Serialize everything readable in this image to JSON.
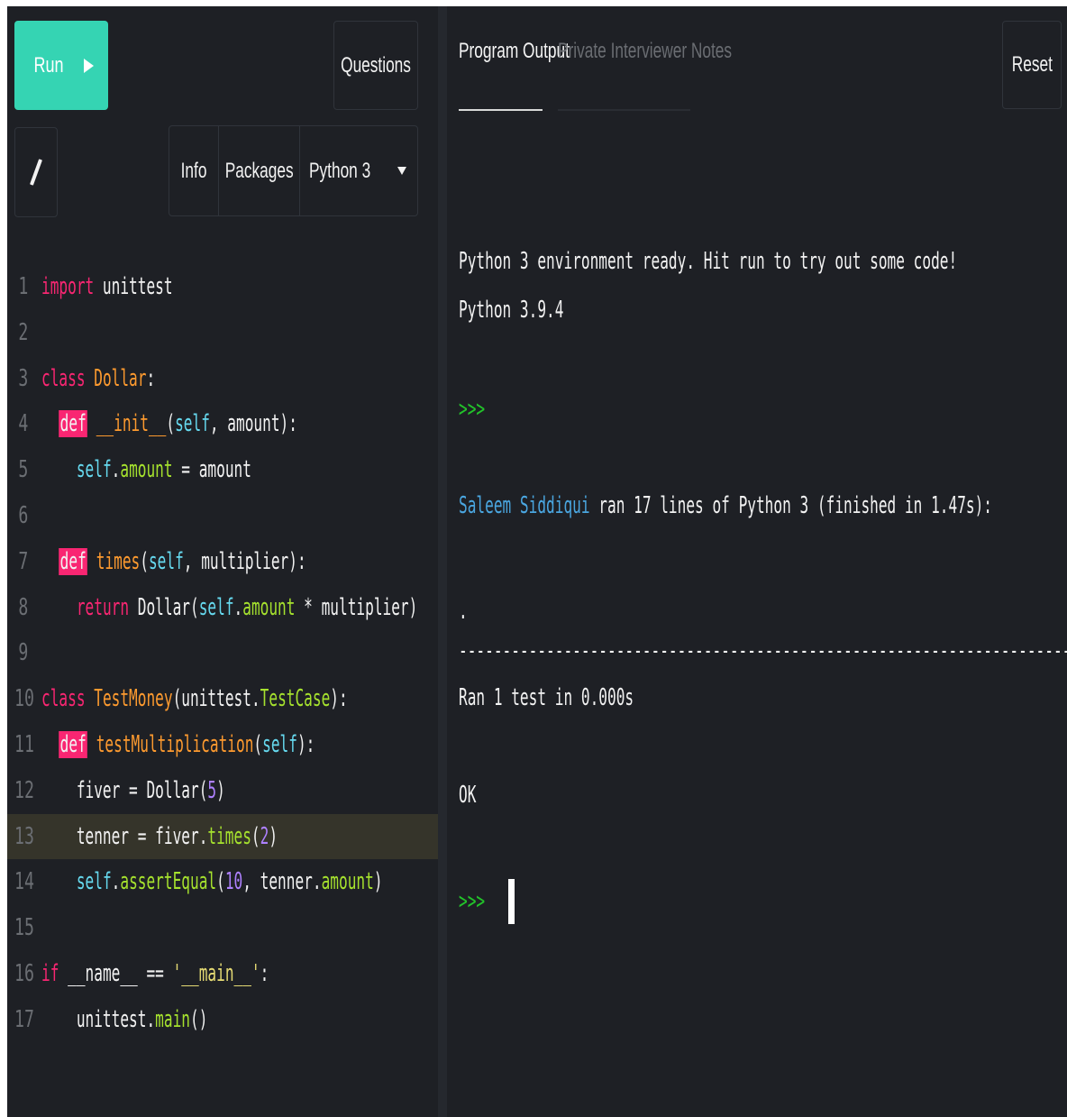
{
  "toolbar": {
    "run_label": "Run",
    "questions_label": "Questions",
    "info_label": "Info",
    "packages_label": "Packages",
    "language": "Python 3"
  },
  "tabs": {
    "output_label": "Program Output",
    "notes_label": "Private Interviewer Notes",
    "reset_label": "Reset"
  },
  "editor": {
    "highlighted_line": 13,
    "line_numbers": [
      "1",
      "2",
      "3",
      "4",
      "5",
      "6",
      "7",
      "8",
      "9",
      "10",
      "11",
      "12",
      "13",
      "14",
      "15",
      "16",
      "17"
    ]
  },
  "console": {
    "ready_text": "Python 3 environment ready. Hit run to try out some code!",
    "version_text": "Python 3.9.4",
    "prompt": ">>>",
    "user_name": "Saleem Siddiqui",
    "run_summary": " ran 17 lines of Python 3 (finished in 1.47s):",
    "dot_line": ".",
    "separator": "----------------------------------------------------------------------",
    "ran_line": "Ran 1 test in 0.000s",
    "ok_line": "OK"
  },
  "colors": {
    "run_button": "#35d4b3",
    "keyword": "#f92672",
    "class_name": "#fd9a2f",
    "function": "#a6e22e",
    "self": "#66d9ef",
    "number": "#ae81ff",
    "prompt": "#22c32a",
    "user": "#4aa6e0"
  }
}
